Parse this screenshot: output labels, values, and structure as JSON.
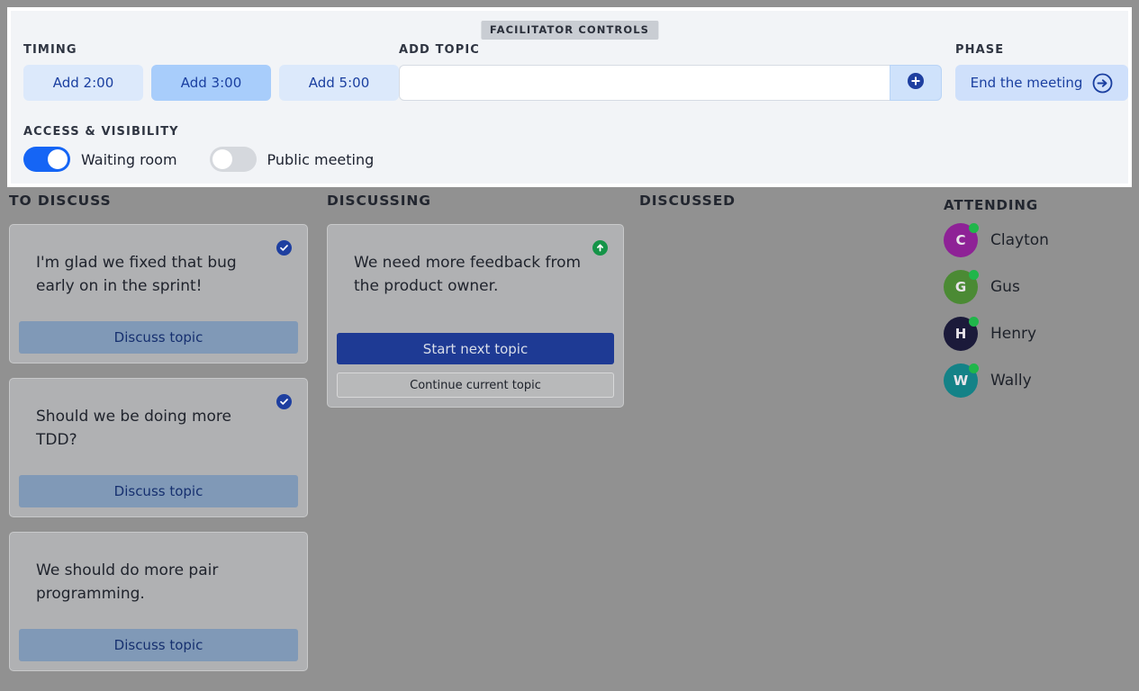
{
  "facilitator": {
    "badge": "FACILITATOR CONTROLS",
    "timing": {
      "label": "TIMING",
      "buttons": [
        {
          "label": "Add 2:00",
          "state": "normal"
        },
        {
          "label": "Add 3:00",
          "state": "hovered"
        },
        {
          "label": "Add 5:00",
          "state": "normal"
        }
      ]
    },
    "add_topic": {
      "label": "ADD TOPIC",
      "input_value": "",
      "input_placeholder": "",
      "button_icon": "plus-circle-icon"
    },
    "phase": {
      "label": "PHASE",
      "end_meeting_label": "End the meeting",
      "end_meeting_icon": "arrow-right-circle-icon"
    },
    "access": {
      "label": "ACCESS & VISIBILITY",
      "toggles": [
        {
          "label": "Waiting room",
          "on": true
        },
        {
          "label": "Public meeting",
          "on": false
        }
      ]
    }
  },
  "board": {
    "to_discuss": {
      "title": "TO DISCUSS",
      "cards": [
        {
          "text": "I'm glad we fixed that bug early on in the sprint!",
          "badge": "check",
          "action": "Discuss topic"
        },
        {
          "text": "Should we be doing more TDD?",
          "badge": "check",
          "action": "Discuss topic"
        },
        {
          "text": "We should do more pair programming.",
          "badge": "none",
          "action": "Discuss topic"
        }
      ]
    },
    "discussing": {
      "title": "DISCUSSING",
      "card": {
        "text": "We need more feedback from the product owner.",
        "badge": "up",
        "primary_action": "Start next topic",
        "secondary_action": "Continue current topic"
      }
    },
    "discussed": {
      "title": "DISCUSSED",
      "cards": []
    }
  },
  "attending": {
    "title": "ATTENDING",
    "people": [
      {
        "name": "Clayton",
        "initial": "C",
        "color": "#8e2296",
        "online": true
      },
      {
        "name": "Gus",
        "initial": "G",
        "color": "#4b8a34",
        "online": true
      },
      {
        "name": "Henry",
        "initial": "H",
        "color": "#1b1a3a",
        "online": true
      },
      {
        "name": "Wally",
        "initial": "W",
        "color": "#148287",
        "online": true
      }
    ]
  },
  "colors": {
    "page_background": "#919191",
    "panel_background": "#f2f4f7",
    "accent_blue": "#1e3fa0",
    "toggle_on": "#1565f5",
    "badge_green": "#159448"
  }
}
